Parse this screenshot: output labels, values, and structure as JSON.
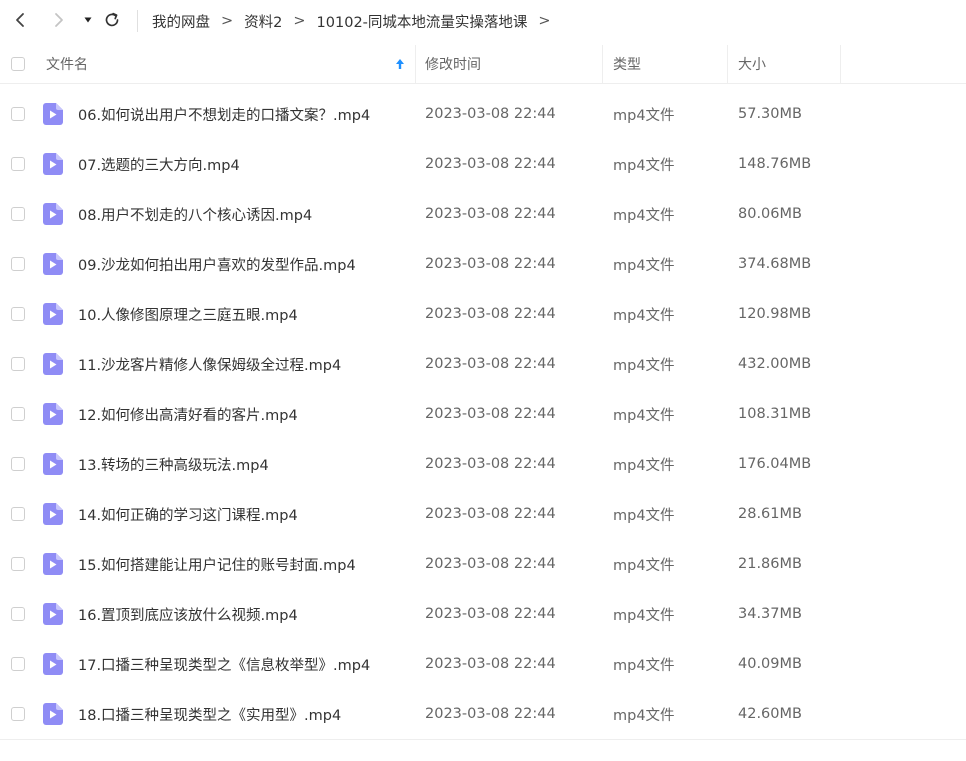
{
  "nav": {
    "back_icon": "chevron-left-icon",
    "forward_icon": "chevron-right-icon",
    "dropdown_icon": "caret-down-icon",
    "refresh_icon": "refresh-icon"
  },
  "breadcrumb": {
    "items": [
      "我的网盘",
      "资料2",
      "10102-同城本地流量实操落地课"
    ],
    "separator": ">"
  },
  "table": {
    "headers": {
      "name": "文件名",
      "modified": "修改时间",
      "type": "类型",
      "size": "大小"
    },
    "sort_icon": "sort-up-arrow-icon",
    "accent_color": "#1e90ff",
    "file_icon_color": "#8f8cf5",
    "rows": [
      {
        "name": "06.如何说出用户不想划走的口播文案？.mp4",
        "modified": "2023-03-08 22:44",
        "type": "mp4文件",
        "size": "57.30MB"
      },
      {
        "name": "07.选题的三大方向.mp4",
        "modified": "2023-03-08 22:44",
        "type": "mp4文件",
        "size": "148.76MB"
      },
      {
        "name": "08.用户不划走的八个核心诱因.mp4",
        "modified": "2023-03-08 22:44",
        "type": "mp4文件",
        "size": "80.06MB"
      },
      {
        "name": "09.沙龙如何拍出用户喜欢的发型作品.mp4",
        "modified": "2023-03-08 22:44",
        "type": "mp4文件",
        "size": "374.68MB"
      },
      {
        "name": "10.人像修图原理之三庭五眼.mp4",
        "modified": "2023-03-08 22:44",
        "type": "mp4文件",
        "size": "120.98MB"
      },
      {
        "name": "11.沙龙客片精修人像保姆级全过程.mp4",
        "modified": "2023-03-08 22:44",
        "type": "mp4文件",
        "size": "432.00MB"
      },
      {
        "name": "12.如何修出高清好看的客片.mp4",
        "modified": "2023-03-08 22:44",
        "type": "mp4文件",
        "size": "108.31MB"
      },
      {
        "name": "13.转场的三种高级玩法.mp4",
        "modified": "2023-03-08 22:44",
        "type": "mp4文件",
        "size": "176.04MB"
      },
      {
        "name": "14.如何正确的学习这门课程.mp4",
        "modified": "2023-03-08 22:44",
        "type": "mp4文件",
        "size": "28.61MB"
      },
      {
        "name": "15.如何搭建能让用户记住的账号封面.mp4",
        "modified": "2023-03-08 22:44",
        "type": "mp4文件",
        "size": "21.86MB"
      },
      {
        "name": "16.置顶到底应该放什么视频.mp4",
        "modified": "2023-03-08 22:44",
        "type": "mp4文件",
        "size": "34.37MB"
      },
      {
        "name": "17.口播三种呈现类型之《信息枚举型》.mp4",
        "modified": "2023-03-08 22:44",
        "type": "mp4文件",
        "size": "40.09MB"
      },
      {
        "name": "18.口播三种呈现类型之《实用型》.mp4",
        "modified": "2023-03-08 22:44",
        "type": "mp4文件",
        "size": "42.60MB"
      }
    ]
  }
}
